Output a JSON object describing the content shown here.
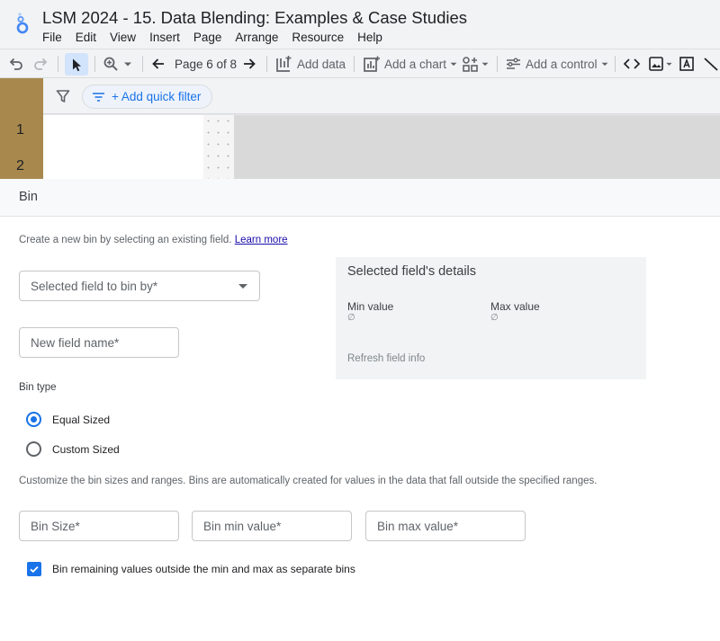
{
  "app": {
    "title": "LSM 2024 - 15. Data Blending: Examples & Case Studies",
    "menu": [
      "File",
      "Edit",
      "View",
      "Insert",
      "Page",
      "Arrange",
      "Resource",
      "Help"
    ]
  },
  "toolbar": {
    "page_indicator": "Page 6 of 8",
    "add_data": "Add data",
    "add_chart": "Add a chart",
    "add_control": "Add a control"
  },
  "canvas": {
    "quick_filter": "+ Add quick filter",
    "rows": [
      "1",
      "2"
    ]
  },
  "bin_panel": {
    "title": "Bin",
    "helper_text": "Create a new bin by selecting an existing field.",
    "learn_more": "Learn more",
    "select_field_placeholder": "Selected field to bin by*",
    "new_field_placeholder": "New field name*",
    "details": {
      "title": "Selected field's details",
      "min_label": "Min value",
      "min_value": "∅",
      "max_label": "Max value",
      "max_value": "∅",
      "refresh": "Refresh field info"
    },
    "bin_type_label": "Bin type",
    "bin_types": [
      {
        "label": "Equal Sized",
        "checked": true
      },
      {
        "label": "Custom Sized",
        "checked": false
      }
    ],
    "description": "Customize the bin sizes and ranges. Bins are automatically created for values in the data that fall outside the specified ranges.",
    "bin_size_placeholder": "Bin Size*",
    "bin_min_placeholder": "Bin min value*",
    "bin_max_placeholder": "Bin max value*",
    "remaining_checkbox_label": "Bin remaining values outside the min and max as separate bins",
    "remaining_checked": true
  },
  "colors": {
    "accent": "#1a73e8",
    "toolbar_bg": "#f1f3f4",
    "row_gutter": "#a8884d"
  }
}
